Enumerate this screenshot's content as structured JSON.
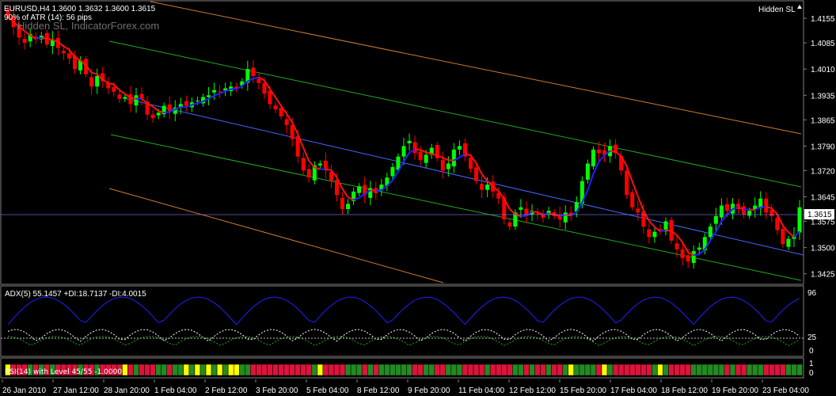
{
  "chart_data": {
    "type": "candlestick",
    "symbol_line": "EURUSD,H4  1.3600 1.3632 1.3600 1.3615",
    "atr_line": "90% of ATR (14): 56 pips",
    "watermark": "Hidden SL, IndicatorForex.com",
    "indicator_name": "Hidden SL",
    "price_axis": {
      "range": [
        1.3395,
        1.4205
      ],
      "ticks": [
        "1.4155",
        "1.4085",
        "1.4010",
        "1.3935",
        "1.3865",
        "1.3790",
        "1.3720",
        "1.3645",
        "1.3575",
        "1.3500",
        "1.3425"
      ],
      "current_price": "1.3615"
    },
    "time_labels": [
      "26 Jan 2010",
      "27 Jan 12:00",
      "28 Jan 20:00",
      "1 Feb 04:00",
      "2 Feb 12:00",
      "3 Feb 20:00",
      "5 Feb 04:00",
      "8 Feb 12:00",
      "9 Feb 20:00",
      "11 Feb 04:00",
      "12 Feb 12:00",
      "15 Feb 20:00",
      "17 Feb 04:00",
      "18 Feb 12:00",
      "19 Feb 20:00",
      "23 Feb 04:00"
    ],
    "closes": [
      1.416,
      1.413,
      1.41,
      1.4085,
      1.411,
      1.4095,
      1.4105,
      1.408,
      1.4095,
      1.407,
      1.4055,
      1.404,
      1.401,
      1.4035,
      1.3995,
      1.396,
      1.399,
      1.3975,
      1.3955,
      1.3945,
      1.3925,
      1.393,
      1.391,
      1.3935,
      1.3925,
      1.388,
      1.387,
      1.3885,
      1.3905,
      1.389,
      1.39,
      1.391,
      1.3905,
      1.3915,
      1.392,
      1.393,
      1.3935,
      1.395,
      1.3945,
      1.3955,
      1.396,
      1.3955,
      1.3975,
      1.401,
      1.399,
      1.397,
      1.394,
      1.391,
      1.3895,
      1.3875,
      1.385,
      1.381,
      1.376,
      1.372,
      1.37,
      1.3735,
      1.374,
      1.372,
      1.369,
      1.365,
      1.361,
      1.3625,
      1.366,
      1.3675,
      1.365,
      1.367,
      1.3655,
      1.368,
      1.37,
      1.373,
      1.376,
      1.379,
      1.3805,
      1.377,
      1.375,
      1.3765,
      1.3785,
      1.3755,
      1.372,
      1.374,
      1.378,
      1.379,
      1.376,
      1.3725,
      1.369,
      1.3665,
      1.368,
      1.366,
      1.364,
      1.358,
      1.356,
      1.36,
      1.3615,
      1.359,
      1.3605,
      1.3595,
      1.3585,
      1.3605,
      1.359,
      1.358,
      1.36,
      1.3595,
      1.363,
      1.369,
      1.374,
      1.378,
      1.377,
      1.3765,
      1.379,
      1.377,
      1.372,
      1.365,
      1.3615,
      1.36,
      1.356,
      1.353,
      1.3545,
      1.355,
      1.3575,
      1.352,
      1.3495,
      1.347,
      1.346,
      1.349,
      1.35,
      1.353,
      1.356,
      1.359,
      1.362,
      1.3605,
      1.3625,
      1.361,
      1.3595,
      1.3605,
      1.362,
      1.364,
      1.36,
      1.359,
      1.355,
      1.351,
      1.3525,
      1.3535,
      1.3615
    ],
    "adx_panel": {
      "label": "ADX(5) 55.1457 +DI:18.7137 -DI:4.0015",
      "range": [
        0,
        100
      ],
      "ticks": [
        "96",
        "25",
        "0"
      ],
      "level": 25,
      "colors": {
        "adx": "#2020ff",
        "plus_di": "#ffffff",
        "minus_di": "#22aa22"
      }
    },
    "bottom_panel": {
      "label": "RSI(14) with Level 45/55  -1.0000",
      "ticks": [
        "1",
        "0"
      ],
      "colors": {
        "up": "#228b22",
        "down": "#dc143c",
        "neutral": "#ffff00"
      }
    },
    "colors": {
      "bull": "#00ff00",
      "bear": "#ff0000",
      "sl_up": "#2020ff",
      "sl_down": "#ff1010",
      "ma": "#4466ff",
      "band_inner": "#22aa22",
      "band_outer": "#cc7a33",
      "grid": "#808080",
      "current": "#8080ff"
    }
  }
}
